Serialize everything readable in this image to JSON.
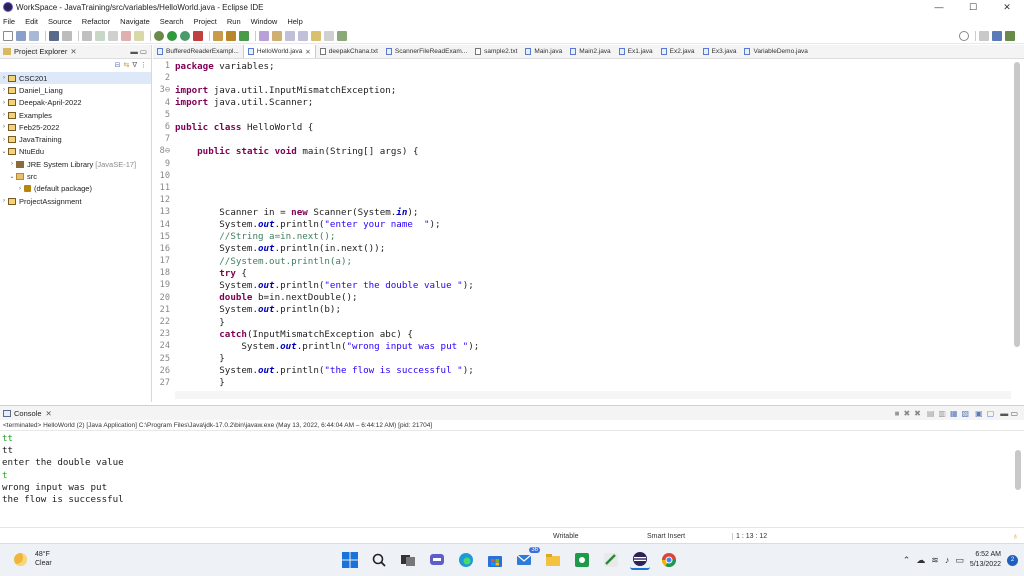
{
  "window": {
    "title": "WorkSpace - JavaTraining/src/variables/HelloWorld.java - Eclipse IDE",
    "controls": {
      "minimize": "—",
      "maximize": "☐",
      "close": "✕"
    }
  },
  "menubar": {
    "items": [
      "File",
      "Edit",
      "Source",
      "Refactor",
      "Navigate",
      "Search",
      "Project",
      "Run",
      "Window",
      "Help"
    ]
  },
  "explorer": {
    "tab_label": "Project Explorer",
    "items": [
      {
        "label": "CSC201",
        "type": "project",
        "selected": true
      },
      {
        "label": "Daniel_Liang",
        "type": "project"
      },
      {
        "label": "Deepak-April-2022",
        "type": "project"
      },
      {
        "label": "Examples",
        "type": "project"
      },
      {
        "label": "Feb25-2022",
        "type": "project"
      },
      {
        "label": "JavaTraining",
        "type": "project"
      },
      {
        "label": "NtuEdu",
        "type": "project",
        "expanded": true
      },
      {
        "label": "JRE System Library",
        "extra": "[JavaSE-17]",
        "type": "library"
      },
      {
        "label": "src",
        "type": "src",
        "expanded": true
      },
      {
        "label": "(default package)",
        "type": "package"
      },
      {
        "label": "ProjectAssignment",
        "type": "project"
      }
    ]
  },
  "editor": {
    "tabs": [
      {
        "label": "BufferedReaderExampl...",
        "active": false
      },
      {
        "label": "HelloWorld.java",
        "active": true
      },
      {
        "label": "deepakChana.txt",
        "active": false
      },
      {
        "label": "ScannerFileReadExam...",
        "active": false
      },
      {
        "label": "sample2.txt",
        "active": false
      },
      {
        "label": "Main.java",
        "active": false
      },
      {
        "label": "Main2.java",
        "active": false
      },
      {
        "label": "Ex1.java",
        "active": false
      },
      {
        "label": "Ex2.java",
        "active": false
      },
      {
        "label": "Ex3.java",
        "active": false
      },
      {
        "label": "VariableDemo.java",
        "active": false
      }
    ],
    "lines": [
      {
        "n": "1",
        "t": "package variables;"
      },
      {
        "n": "2",
        "t": ""
      },
      {
        "n": "3⊖",
        "t": "import java.util.InputMismatchException;"
      },
      {
        "n": "4",
        "t": "import java.util.Scanner;"
      },
      {
        "n": "5",
        "t": ""
      },
      {
        "n": "6",
        "t": "public class HelloWorld {"
      },
      {
        "n": "7",
        "t": ""
      },
      {
        "n": "8⊖",
        "t": "    public static void main(String[] args) {"
      },
      {
        "n": "9",
        "t": ""
      },
      {
        "n": "10",
        "t": ""
      },
      {
        "n": "11",
        "t": ""
      },
      {
        "n": "12",
        "t": ""
      },
      {
        "n": "13",
        "t": "        Scanner in = new Scanner(System.in);"
      },
      {
        "n": "14",
        "t": "        System.out.println(\"enter your name  \");"
      },
      {
        "n": "15",
        "t": "        //String a=in.next();"
      },
      {
        "n": "16",
        "t": "        System.out.println(in.next());"
      },
      {
        "n": "17",
        "t": "        //System.out.println(a);"
      },
      {
        "n": "18",
        "t": "        try {"
      },
      {
        "n": "19",
        "t": "        System.out.println(\"enter the double value \");"
      },
      {
        "n": "20",
        "t": "        double b=in.nextDouble();"
      },
      {
        "n": "21",
        "t": "        System.out.println(b);"
      },
      {
        "n": "22",
        "t": "        }"
      },
      {
        "n": "23",
        "t": "        catch(InputMismatchException abc) {"
      },
      {
        "n": "24",
        "t": "            System.out.println(\"wrong input was put \");"
      },
      {
        "n": "25",
        "t": "        }"
      },
      {
        "n": "26",
        "t": "        System.out.println(\"the flow is successful \");"
      },
      {
        "n": "27",
        "t": "        }"
      }
    ]
  },
  "console": {
    "tab_label": "Console",
    "status": "<terminated> HelloWorld (2) [Java Application] C:\\Program Files\\Java\\jdk-17.0.2\\bin\\javaw.exe  (May 13, 2022, 6:44:04 AM – 6:44:12 AM) [pid: 21704]",
    "output": [
      {
        "text": "tt",
        "kind": "input"
      },
      {
        "text": "tt",
        "kind": "output"
      },
      {
        "text": "enter the double value",
        "kind": "output"
      },
      {
        "text": "t",
        "kind": "input"
      },
      {
        "text": "wrong input was put",
        "kind": "output"
      },
      {
        "text": "the flow is successful",
        "kind": "output"
      }
    ]
  },
  "statusbar": {
    "mode": "Writable",
    "insert": "Smart Insert",
    "position": "1 : 13 : 12"
  },
  "taskbar": {
    "weather_temp": "48°F",
    "weather_desc": "Clear",
    "time": "6:52 AM",
    "date": "5/13/2022",
    "mail_badge": "36",
    "notification_count": "2"
  },
  "colors": {
    "keyword": "#7f0055",
    "string": "#2a00ff",
    "comment": "#3f7f5f",
    "field": "#0000c0",
    "console_input": "#2aa52a",
    "selection": "#dde8f8"
  }
}
